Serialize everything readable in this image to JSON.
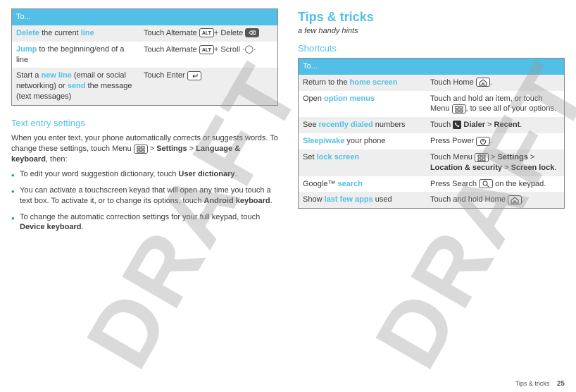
{
  "left": {
    "table": {
      "header": "To...",
      "rows": [
        {
          "c1": [
            "<b class='accent'>Delete</b> the current <b class='accent'>line</b>"
          ],
          "c2": [
            "Touch Alternate ",
            {
              "icon": "ALT"
            },
            "+ Delete ",
            {
              "icon": "⌫",
              "cls": "delkey"
            }
          ],
          "alt": true
        },
        {
          "c1": [
            "<b class='accent'>Jump</b> to the beginning/end of a line"
          ],
          "c2": [
            "Touch Alternate ",
            {
              "icon": "ALT"
            },
            "+ Scroll ",
            {
              "svg": "scroll"
            }
          ],
          "alt": false
        },
        {
          "c1": [
            "Start a <b class='accent'>new line</b> (email or social networking) or <b class='accent'>send</b> the message (text messages)"
          ],
          "c2": [
            "Touch Enter ",
            {
              "svg": "enter"
            }
          ],
          "alt": true
        }
      ]
    },
    "settings_heading": "Text entry settings",
    "settings_p1_pre": "When you enter text, your phone automatically corrects or suggests words. To change these settings, touch Menu ",
    "settings_p1_post": " > <b>Settings</b> > <b>Language & keyboard</b>, then:",
    "bullets": [
      "To edit your word suggestion dictionary, touch <b>User dictionary</b>.",
      "You can activate a touchscreen keyad that will open any time you touch a text box. To activate it, or to change its options, touch <b>Android keyboard</b>.",
      "To change the automatic correction settings for your full keypad, touch <b>Device keyboard</b>."
    ]
  },
  "right": {
    "title": "Tips & tricks",
    "subtitle": "a few handy hints",
    "shortcuts_heading": "Shortcuts",
    "table": {
      "header": "To...",
      "rows": [
        {
          "c1": [
            "Return to the <b class='accent'>home screen</b>"
          ],
          "c2": [
            "Touch Home ",
            {
              "svg": "home"
            },
            "."
          ],
          "alt": true
        },
        {
          "c1": [
            "Open <b class='accent'>option menus</b>"
          ],
          "c2": [
            "Touch and hold an item, or touch Menu ",
            {
              "svg": "menu"
            },
            ", to see all of your options."
          ],
          "alt": false
        },
        {
          "c1": [
            "See <b class='accent'>recently dialed</b> numbers"
          ],
          "c2": [
            "Touch ",
            {
              "svg": "dialer"
            },
            " <b>Dialer</b> > <b>Recent</b>."
          ],
          "alt": true
        },
        {
          "c1": [
            "<b class='accent'>Sleep/wake</b> your phone"
          ],
          "c2": [
            "Press Power ",
            {
              "svg": "power"
            },
            "."
          ],
          "alt": false
        },
        {
          "c1": [
            "Set <b class='accent'>lock screen</b>"
          ],
          "c2": [
            "Touch Menu ",
            {
              "svg": "menu"
            },
            " > <b>Settings</b> > <b>Location & security</b> > <b>Screen lock</b>."
          ],
          "alt": true
        },
        {
          "c1": [
            "Google™ <b class='accent'>search</b>"
          ],
          "c2": [
            "Press Search ",
            {
              "svg": "search"
            },
            " on the keypad."
          ],
          "alt": false
        },
        {
          "c1": [
            "Show <b class='accent'>last few apps</b> used"
          ],
          "c2": [
            "Touch and hold Home ",
            {
              "svg": "home"
            },
            "."
          ],
          "alt": true
        }
      ]
    }
  },
  "footer": {
    "label": "Tips & tricks",
    "page": "25"
  },
  "watermark": "DRAFT"
}
